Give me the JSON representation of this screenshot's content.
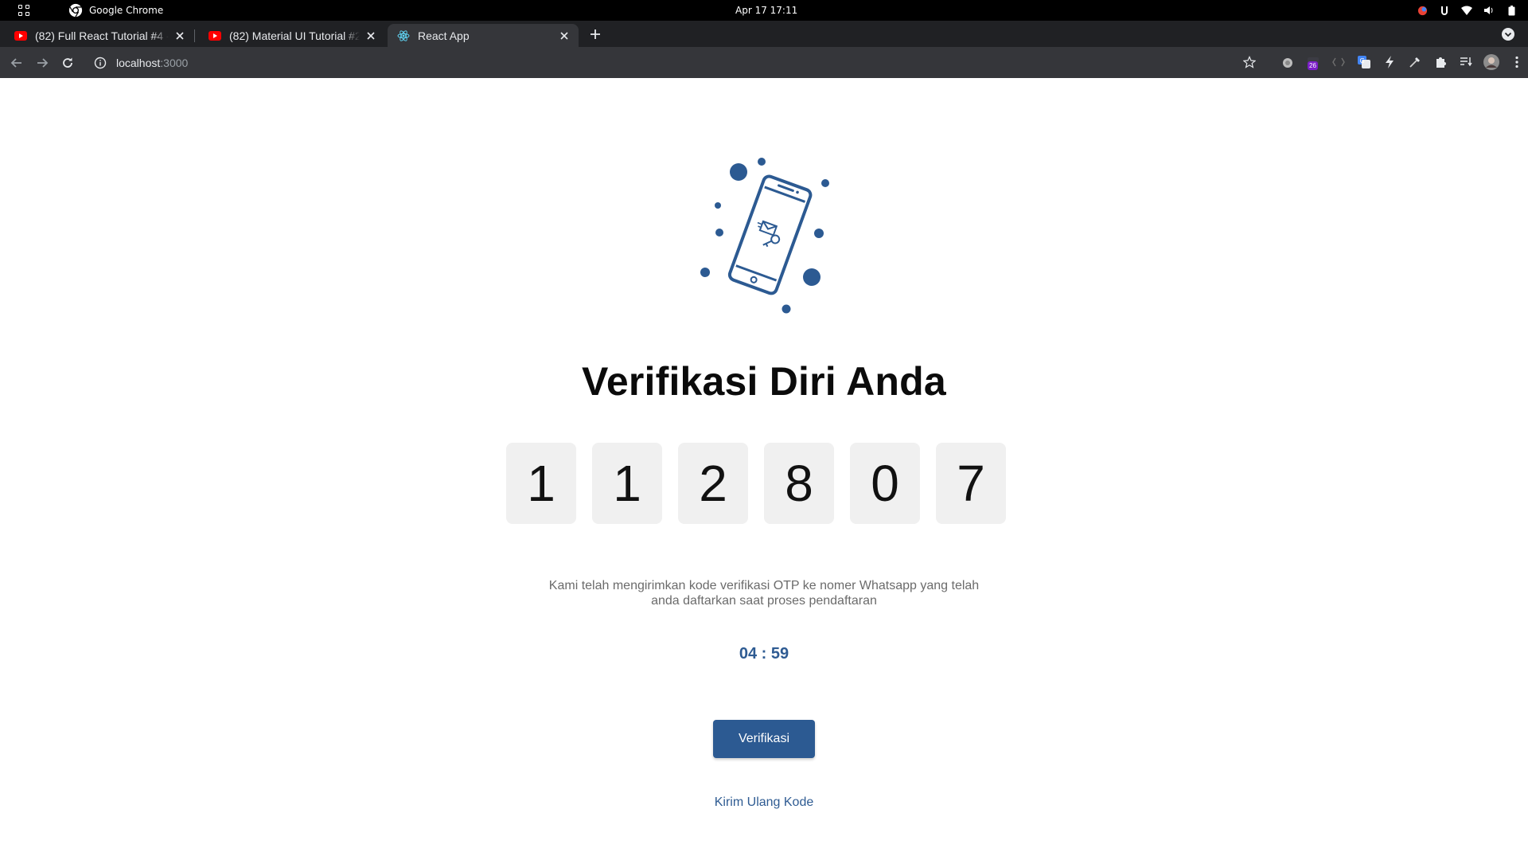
{
  "system_bar": {
    "app_name": "Google Chrome",
    "clock": "Apr 17  17:11"
  },
  "browser": {
    "tabs": [
      {
        "label": "(82) Full React Tutorial #4 -",
        "favicon": "youtube-icon",
        "active": false
      },
      {
        "label": "(82) Material UI Tutorial #2",
        "favicon": "youtube-icon",
        "active": false
      },
      {
        "label": "React App",
        "favicon": "react-icon",
        "active": true
      }
    ],
    "url_host": "localhost",
    "url_port": ":3000",
    "extension_badge": "26"
  },
  "page": {
    "title": "Verifikasi Diri Anda",
    "otp_digits": [
      "1",
      "1",
      "2",
      "8",
      "0",
      "7"
    ],
    "description_line1": "Kami telah mengirimkan kode verifikasi OTP ke nomer Whatsapp yang telah",
    "description_line2": "anda daftarkan saat proses pendaftaran",
    "timer": "04 : 59",
    "verify_button": "Verifikasi",
    "resend_link": "Kirim Ulang Kode",
    "accent_color": "#2c5a92"
  }
}
